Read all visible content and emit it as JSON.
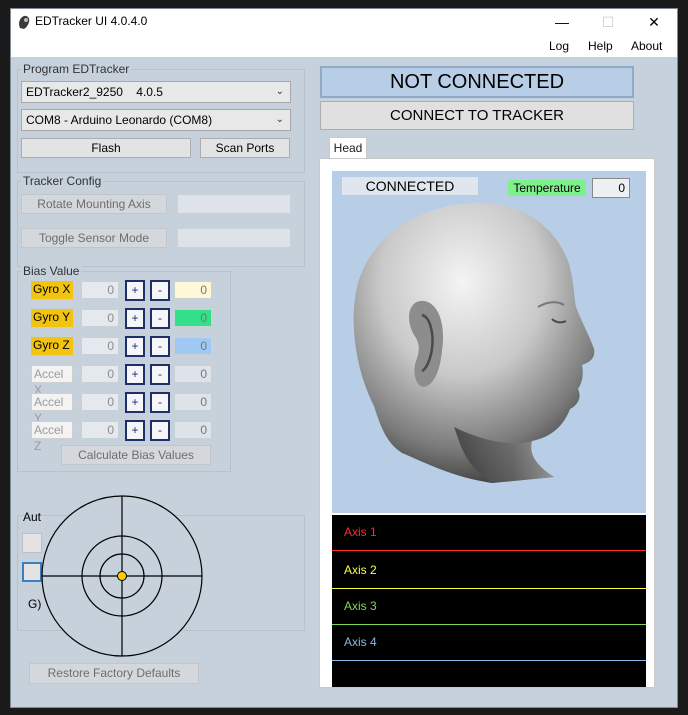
{
  "window": {
    "title": "EDTracker UI 4.0.4.0",
    "controls": {
      "minimize": "—",
      "maximize": "☐",
      "close": "✕"
    }
  },
  "menu": {
    "items": [
      "Log",
      "Help",
      "About"
    ]
  },
  "program": {
    "group_label": "Program EDTracker",
    "firmware_select": "EDTracker2_9250    4.0.5",
    "port_select": "COM8 - Arduino Leonardo (COM8)",
    "flash_label": "Flash",
    "scan_label": "Scan Ports"
  },
  "tracker_config": {
    "group_label": "Tracker Config",
    "rotate_label": "Rotate Mounting Axis",
    "toggle_label": "Toggle Sensor Mode"
  },
  "bias": {
    "group_label": "Bias Value",
    "rows": [
      {
        "label": "Gyro X",
        "value": "0",
        "plus": "+",
        "minus": "-",
        "result": "0"
      },
      {
        "label": "Gyro Y",
        "value": "0",
        "plus": "+",
        "minus": "-",
        "result": "0"
      },
      {
        "label": "Gyro Z",
        "value": "0",
        "plus": "+",
        "minus": "-",
        "result": "0"
      },
      {
        "label": "Accel X",
        "value": "0",
        "plus": "+",
        "minus": "-",
        "result": "0"
      },
      {
        "label": "Accel Y",
        "value": "0",
        "plus": "+",
        "minus": "-",
        "result": "0"
      },
      {
        "label": "Accel Z",
        "value": "0",
        "plus": "+",
        "minus": "-",
        "result": "0"
      }
    ],
    "result_colors": [
      "#fff8d8",
      "#33e089",
      "#9fc8f2",
      "#dde3e9",
      "#dde3e9",
      "#dde3e9"
    ],
    "calculate_label": "Calculate Bias Values"
  },
  "auto": {
    "label_fragment": "Aut",
    "g_fragment": "G)"
  },
  "restore_label": "Restore Factory Defaults",
  "status": {
    "connection": "NOT CONNECTED",
    "connect_label": "CONNECT TO TRACKER"
  },
  "tabs": [
    "Head"
  ],
  "head_view": {
    "connected_label": "CONNECTED",
    "temperature_label": "Temperature",
    "temperature_value": "0"
  },
  "axes": [
    {
      "label": "Axis 1",
      "color": "#ff2a2a"
    },
    {
      "label": "Axis 2",
      "color": "#ffff40"
    },
    {
      "label": "Axis 3",
      "color": "#7bd957"
    },
    {
      "label": "Axis 4",
      "color": "#8ab8e8"
    }
  ]
}
